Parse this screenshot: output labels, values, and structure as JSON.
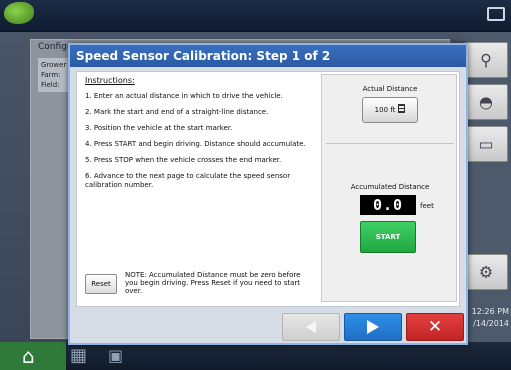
{
  "background": {
    "panel_title": "Configu",
    "labels": [
      "Grower",
      "Farm:",
      "Field:"
    ],
    "clock_time": "12:26 PM",
    "clock_date": "/14/2014"
  },
  "dialog": {
    "title": "Speed Sensor Calibration:  Step 1 of 2",
    "instructions_heading": "Instructions:",
    "instructions": [
      "1. Enter an actual distance in which to drive the vehicle.",
      "2. Mark the start and end of a straight-line distance.",
      "3. Position the vehicle at the start marker.",
      "4. Press START and begin driving. Distance should accumulate.",
      "5. Press STOP when the vehicle crosses the end marker.",
      "6. Advance to the next page to calculate the speed sensor calibration number."
    ],
    "reset_label": "Reset",
    "note": "NOTE:  Accumulated Distance must be zero before you begin driving.  Press Reset if you need to start over.",
    "actual_distance_label": "Actual Distance",
    "actual_distance_value": "100 ft",
    "accumulated_label": "Accumulated Distance",
    "accumulated_value": "0.0",
    "accumulated_unit": "feet",
    "start_label": "START",
    "back_enabled": false
  },
  "colors": {
    "title_bar": "#2a5aa5",
    "next_button": "#1f6fc5",
    "cancel_button": "#c22424",
    "start_button": "#21a840",
    "home_button": "#2f7a39"
  },
  "icons": [
    "home-icon",
    "grid-icon",
    "camera-icon",
    "calculator-icon",
    "back-arrow-icon",
    "next-arrow-icon",
    "close-icon"
  ]
}
